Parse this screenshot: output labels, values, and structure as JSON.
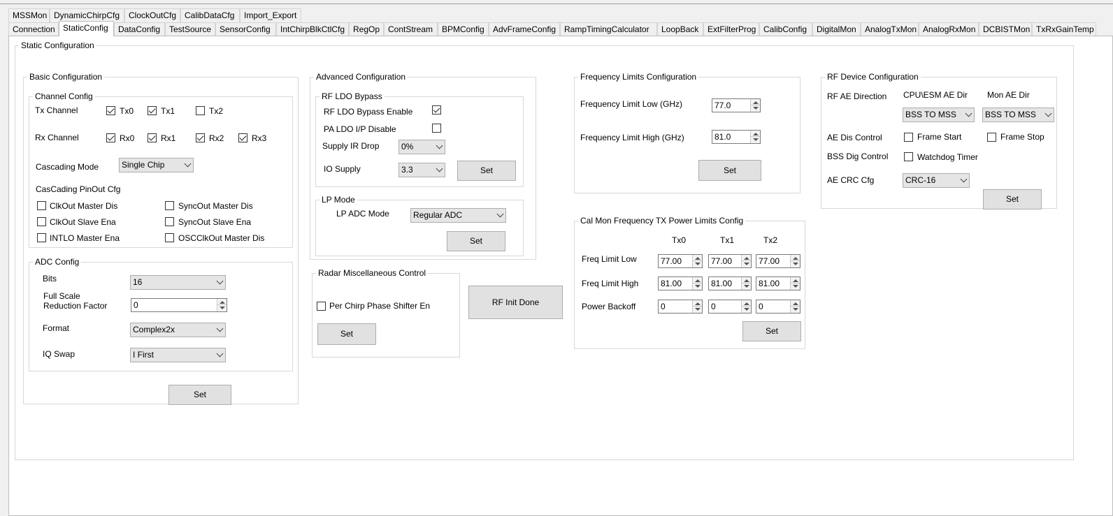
{
  "tabs": {
    "row1": [
      "MSSMon",
      "DynamicChirpCfg",
      "ClockOutCfg",
      "CalibDataCfg",
      "Import_Export"
    ],
    "row2": [
      "Connection",
      "StaticConfig",
      "DataConfig",
      "TestSource",
      "SensorConfig",
      "IntChirpBlkCtlCfg",
      "RegOp",
      "ContStream",
      "BPMConfig",
      "AdvFrameConfig",
      "RampTimingCalculator",
      "LoopBack",
      "ExtFilterProg",
      "CalibConfig",
      "DigitalMon",
      "AnalogTxMon",
      "AnalogRxMon",
      "DCBISTMon",
      "TxRxGainTemp"
    ]
  },
  "static_config": {
    "title": "Static Configuration",
    "basic": {
      "title": "Basic Configuration",
      "channel": {
        "title": "Channel Config",
        "tx_label": "Tx Channel",
        "tx": [
          {
            "label": "Tx0",
            "checked": true
          },
          {
            "label": "Tx1",
            "checked": true
          },
          {
            "label": "Tx2",
            "checked": false
          }
        ],
        "rx_label": "Rx Channel",
        "rx": [
          {
            "label": "Rx0",
            "checked": true
          },
          {
            "label": "Rx1",
            "checked": true
          },
          {
            "label": "Rx2",
            "checked": true
          },
          {
            "label": "Rx3",
            "checked": true
          }
        ],
        "cascading_label": "Cascading Mode",
        "cascading_value": "Single Chip",
        "pinout_label": "CasCading PinOut Cfg",
        "pinout": [
          {
            "label": "ClkOut Master Dis",
            "checked": false
          },
          {
            "label": "SyncOut Master Dis",
            "checked": false
          },
          {
            "label": "ClkOut Slave Ena",
            "checked": false
          },
          {
            "label": "SyncOut Slave Ena",
            "checked": false
          },
          {
            "label": "INTLO Master Ena",
            "checked": false
          },
          {
            "label": "OSCClkOut Master Dis",
            "checked": false
          }
        ]
      },
      "adc": {
        "title": "ADC Config",
        "bits_label": "Bits",
        "bits_value": "16",
        "fsrf_label_1": "Full Scale",
        "fsrf_label_2": "Reduction Factor",
        "fsrf_value": "0",
        "format_label": "Format",
        "format_value": "Complex2x",
        "iq_label": "IQ Swap",
        "iq_value": "I First"
      },
      "set": "Set"
    },
    "advanced": {
      "title": "Advanced Configuration",
      "ldo": {
        "title": "RF LDO Bypass",
        "bypass_label": "RF LDO Bypass Enable",
        "bypass_checked": true,
        "pa_label": "PA LDO I/P Disable",
        "pa_checked": false,
        "irdrop_label": "Supply IR Drop",
        "irdrop_value": "0%",
        "io_label": "IO Supply",
        "io_value": "3.3",
        "set": "Set"
      },
      "lp": {
        "title": "LP Mode",
        "adc_label": "LP ADC Mode",
        "adc_value": "Regular ADC",
        "set": "Set"
      }
    },
    "radar_misc": {
      "title": "Radar Miscellaneous Control",
      "phase_label": "Per Chirp Phase Shifter En",
      "phase_checked": false,
      "set": "Set"
    },
    "rf_init": "RF Init Done",
    "freq_limits": {
      "title": "Frequency Limits Configuration",
      "low_label": "Frequency Limit Low (GHz)",
      "low_value": "77.0",
      "high_label": "Frequency Limit High (GHz)",
      "high_value": "81.0",
      "set": "Set"
    },
    "calmon": {
      "title": "Cal Mon Frequency TX Power Limits Config",
      "cols": [
        "Tx0",
        "Tx1",
        "Tx2"
      ],
      "rows": [
        {
          "label": "Freq Limit Low",
          "values": [
            "77.00",
            "77.00",
            "77.00"
          ]
        },
        {
          "label": "Freq Limit High",
          "values": [
            "81.00",
            "81.00",
            "81.00"
          ]
        },
        {
          "label": "Power Backoff",
          "values": [
            "0",
            "0",
            "0"
          ]
        }
      ],
      "set": "Set"
    },
    "rf_device": {
      "title": "RF Device Configuration",
      "ae_dir_label": "RF AE Direction",
      "cpu_label": "CPU\\ESM AE Dir",
      "mon_label": "Mon AE Dir",
      "cpu_value": "BSS TO MSS",
      "mon_value": "BSS TO MSS",
      "ae_dis_label": "AE Dis Control",
      "frame_start_label": "Frame Start",
      "frame_start_checked": false,
      "frame_stop_label": "Frame Stop",
      "frame_stop_checked": false,
      "bss_label": "BSS Dig Control",
      "watchdog_label": "Watchdog Timer",
      "watchdog_checked": false,
      "crc_label": "AE CRC Cfg",
      "crc_value": "CRC-16",
      "set": "Set"
    }
  }
}
